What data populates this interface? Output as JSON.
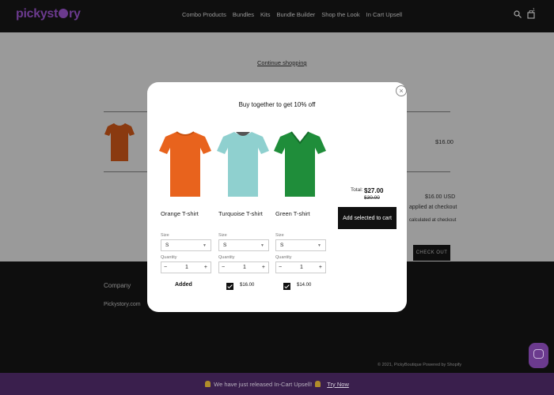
{
  "header": {
    "logo": "pickyst",
    "logo_tail": "ry",
    "nav": [
      "Combo Products",
      "Bundles",
      "Kits",
      "Bundle Builder",
      "Shop the Look",
      "In Cart Upsell"
    ],
    "cart_count": "1",
    "icons": [
      "search-icon",
      "cart-icon"
    ]
  },
  "page": {
    "continue": "Continue shopping",
    "line_price": "$16.00",
    "subtotal": "$16.00 USD",
    "applied": "applied at checkout",
    "calc": "calculated at checkout",
    "checkout": "CHECK OUT"
  },
  "footer": {
    "company": "Company",
    "link": "Pickystory.com",
    "copyright": "© 2021, PickyBoutique Powered by Shopify"
  },
  "announcement": {
    "text": "We have just released In-Cart Upsell!",
    "link": "Try Now"
  },
  "modal": {
    "title": "Buy together to get 10% off",
    "close": "×",
    "size_label": "Size",
    "qty_label": "Quantity",
    "products": [
      {
        "name": "Orange T-shirt",
        "size": "S",
        "qty": "1",
        "status": "Added",
        "color": "#e8631d"
      },
      {
        "name": "Turquoise T-shirt",
        "size": "S",
        "qty": "1",
        "price": "$16.00",
        "checked": true,
        "color": "#8fd0cf"
      },
      {
        "name": "Green T-shirt",
        "size": "S",
        "qty": "1",
        "price": "$14.00",
        "checked": true,
        "color": "#1f8d3a"
      }
    ],
    "total_label": "Total:",
    "total": "$27.00",
    "total_old": "$30.00",
    "add_button": "Add selected to cart"
  },
  "colors": {
    "brand": "#6b3a8e",
    "overlay_bg": "#9a9a9a",
    "dark": "#0f0f0f"
  }
}
